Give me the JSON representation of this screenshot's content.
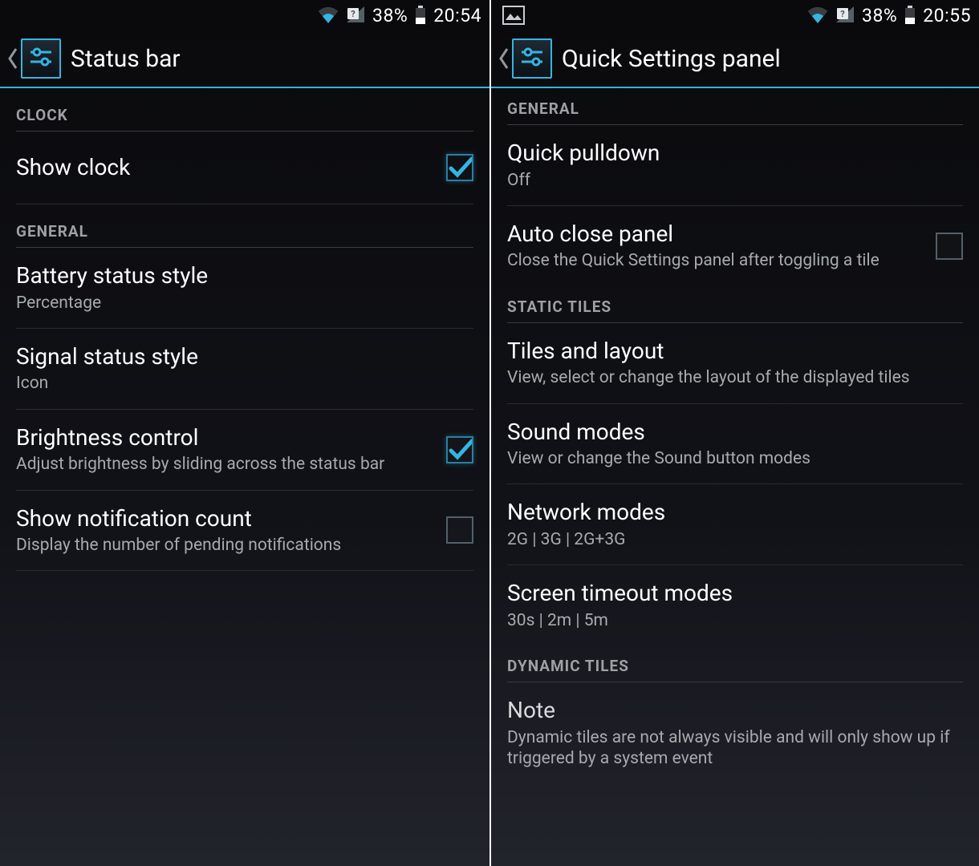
{
  "left": {
    "status": {
      "battery_pct": "38%",
      "time": "20:54",
      "has_picture_icon": false
    },
    "title": "Status bar",
    "sections": [
      {
        "header": "CLOCK",
        "rows": [
          {
            "title": "Show clock",
            "sub": null,
            "checked": true,
            "id": "show-clock"
          }
        ]
      },
      {
        "header": "GENERAL",
        "rows": [
          {
            "title": "Battery status style",
            "sub": "Percentage",
            "id": "battery-status-style"
          },
          {
            "title": "Signal status style",
            "sub": "Icon",
            "id": "signal-status-style"
          },
          {
            "title": "Brightness control",
            "sub": "Adjust brightness by sliding across the status bar",
            "checked": true,
            "id": "brightness-control"
          },
          {
            "title": "Show notification count",
            "sub": "Display the number of pending notifications",
            "checked": false,
            "id": "show-notification-count"
          }
        ]
      }
    ]
  },
  "right": {
    "status": {
      "battery_pct": "38%",
      "time": "20:55",
      "has_picture_icon": true
    },
    "title": "Quick Settings panel",
    "sections": [
      {
        "header": "GENERAL",
        "rows": [
          {
            "title": "Quick pulldown",
            "sub": "Off",
            "id": "quick-pulldown"
          },
          {
            "title": "Auto close panel",
            "sub": "Close the Quick Settings panel after toggling a tile",
            "checked": false,
            "id": "auto-close-panel"
          }
        ]
      },
      {
        "header": "STATIC TILES",
        "rows": [
          {
            "title": "Tiles and layout",
            "sub": "View, select or change the layout of the displayed tiles",
            "id": "tiles-and-layout"
          },
          {
            "title": "Sound modes",
            "sub": "View or change the Sound button modes",
            "id": "sound-modes"
          },
          {
            "title": "Network modes",
            "sub": "2G | 3G | 2G+3G",
            "id": "network-modes"
          },
          {
            "title": "Screen timeout modes",
            "sub": "30s | 2m | 5m",
            "id": "screen-timeout-modes"
          }
        ]
      },
      {
        "header": "DYNAMIC TILES",
        "rows": [
          {
            "title": "Note",
            "sub": "Dynamic tiles are not always visible and will only show up if triggered by a system event",
            "id": "dynamic-note",
            "note": true
          }
        ]
      }
    ]
  }
}
